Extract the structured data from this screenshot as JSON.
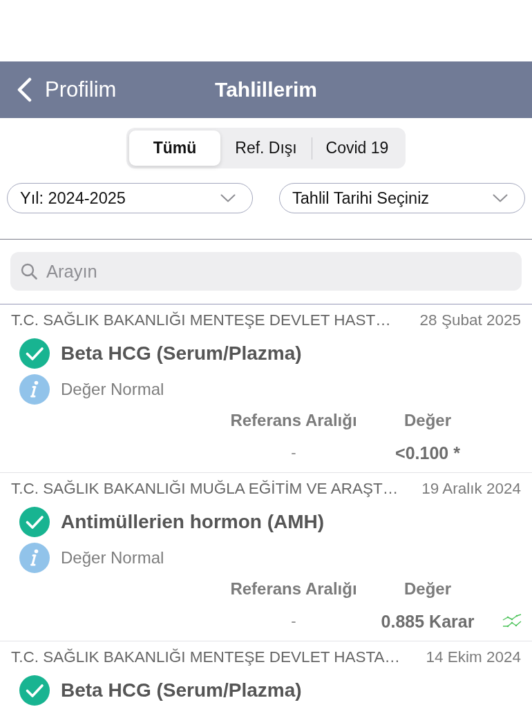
{
  "nav_bar": {
    "back_label": "Profilim",
    "title": "Tahlillerim"
  },
  "tabs": [
    {
      "label": "Tümü",
      "selected": true
    },
    {
      "label": "Ref. Dışı",
      "selected": false
    },
    {
      "label": "Covid 19",
      "selected": false
    }
  ],
  "filters": [
    {
      "label": "Yıl: 2024-2025"
    },
    {
      "label": "Tahlil Tarihi Seçiniz"
    }
  ],
  "search": {
    "placeholder": "Arayın"
  },
  "results": [
    {
      "hospital": "T.C. SAĞLIK BAKANLIĞI MENTEŞE DEVLET HAST…",
      "date": "28 Şubat 2025",
      "test": "Beta HCG (Serum/Plazma)",
      "status": "Değer Normal",
      "reference_header": "Referans Aralığı",
      "value_header": "Değer",
      "reference": "-",
      "value": "<0.100 *",
      "trend": false
    },
    {
      "hospital": "T.C. SAĞLIK BAKANLIĞI MUĞLA EĞİTİM VE ARAŞT…",
      "date": "19 Aralık 2024",
      "test": "Antimüllerien hormon (AMH)",
      "status": "Değer Normal",
      "reference_header": "Referans Aralığı",
      "value_header": "Değer",
      "reference": "-",
      "value": "0.885 Karar",
      "trend": true
    },
    {
      "hospital": "T.C. SAĞLIK BAKANLIĞI MENTEŞE DEVLET HASTA…",
      "date": "14 Ekim 2024",
      "test": "Beta HCG (Serum/Plazma)"
    }
  ]
}
